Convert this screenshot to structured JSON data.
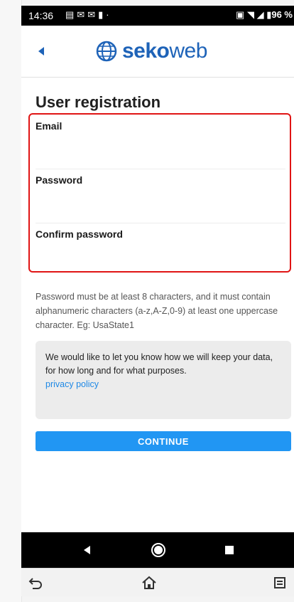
{
  "status_bar": {
    "time": "14:36",
    "notification_icons": [
      "message-icon",
      "mail-icon",
      "mail-icon",
      "sim-icon"
    ],
    "battery_text": "96 %"
  },
  "header": {
    "brand_bold": "seko",
    "brand_light": "web",
    "brand_color": "#1e63b8"
  },
  "form": {
    "title": "User registration",
    "fields": [
      {
        "label": "Email",
        "value": "",
        "placeholder": ""
      },
      {
        "label": "Password",
        "value": "",
        "placeholder": ""
      },
      {
        "label": "Confirm password",
        "value": "",
        "placeholder": ""
      }
    ],
    "highlight_color": "#e01414"
  },
  "password_hint": "Password must be at least 8 characters, and it must contain alphanumeric characters (a-z,A-Z,0-9) at least one uppercase character. Eg: UsaState1",
  "privacy": {
    "text": "We would like to let you know how we will keep your data, for how long and for what purposes.",
    "link_label": "privacy policy",
    "link_color": "#1e88e5"
  },
  "continue_button": {
    "label": "CONTINUE",
    "color": "#2196f3"
  },
  "system_nav": {
    "icons": [
      "back-triangle-icon",
      "home-circle-icon",
      "recent-square-icon"
    ]
  },
  "browser_bar": {
    "icons": [
      "return-arrow-icon",
      "home-icon",
      "menu-icon"
    ]
  }
}
